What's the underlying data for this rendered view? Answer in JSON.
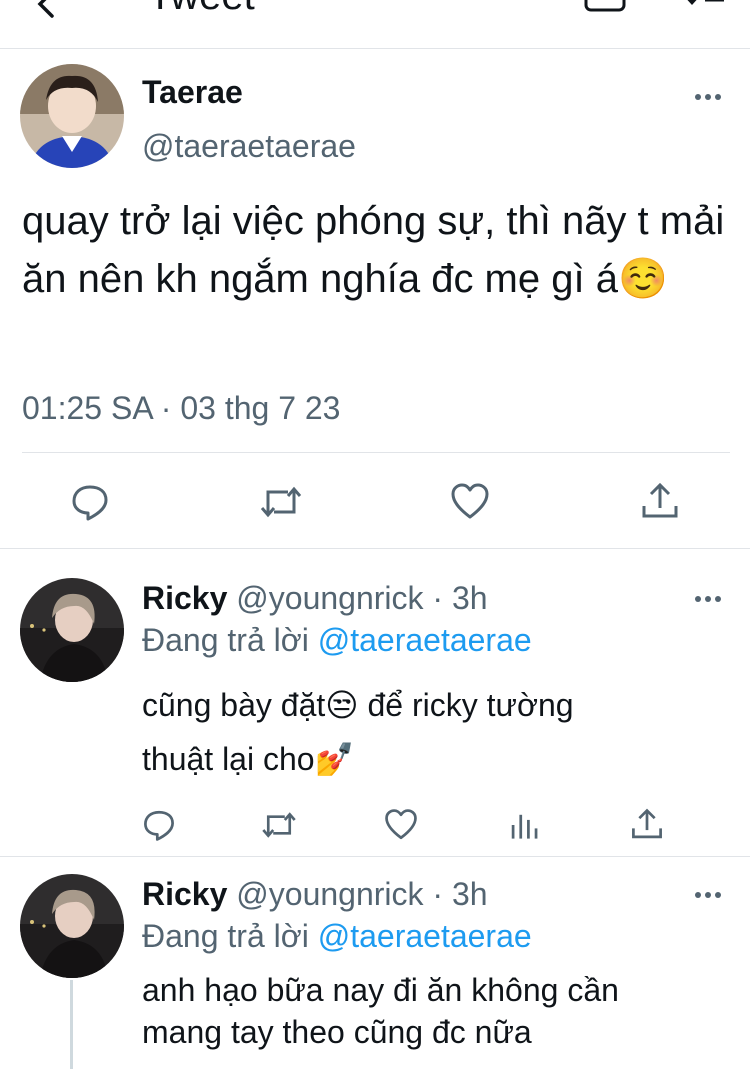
{
  "header": {
    "title": "Tweet"
  },
  "main_tweet": {
    "name": "Taerae",
    "handle": "@taeraetaerae",
    "text": "quay trở lại việc phóng sự, thì nãy t mải ăn nên kh ngắm nghía đc mẹ gì á☺️",
    "timestamp": "01:25 SA · 03 thg 7 23"
  },
  "replies": [
    {
      "name": "Ricky",
      "handle": "@youngnrick",
      "time": "· 3h",
      "replying_label": "Đang trả lời",
      "replying_to": "@taeraetaerae",
      "text_line1": "cũng bày đặt😒  để ricky tường",
      "text_line2": "thuật lại cho💅"
    },
    {
      "name": "Ricky",
      "handle": "@youngnrick",
      "time": "· 3h",
      "replying_label": "Đang trả lời",
      "replying_to": "@taeraetaerae",
      "text_line1": "anh hạo bữa nay đi ăn không cần",
      "text_line2": "mang tay theo cũng đc nữa"
    }
  ],
  "colors": {
    "accent": "#1d9bf0",
    "secondary_text": "#536471",
    "divider": "#e1e4e8"
  }
}
